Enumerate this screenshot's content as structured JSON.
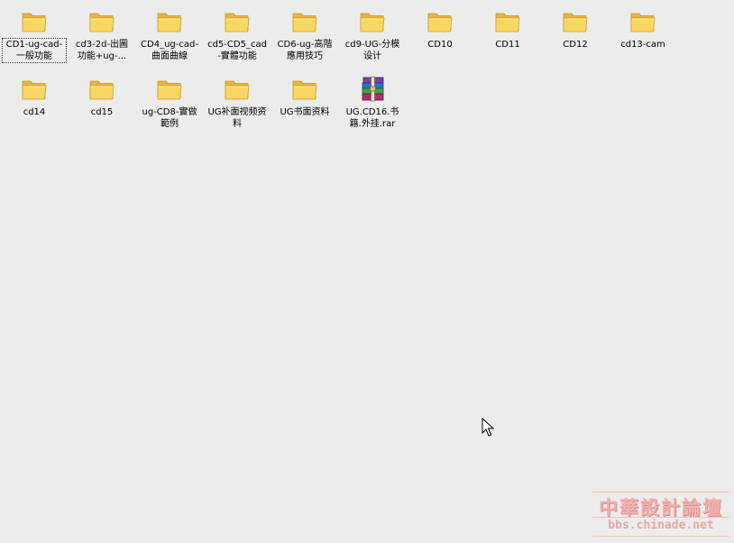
{
  "items": [
    {
      "label": "CD1-ug-cad-一般功能",
      "icon": "folder-icon",
      "selected": true
    },
    {
      "label": "cd3-2d-出圖功能+ug-...",
      "icon": "folder-icon"
    },
    {
      "label": "CD4_ug-cad-曲面曲線",
      "icon": "folder-icon"
    },
    {
      "label": "cd5-CD5_cad-實體功能",
      "icon": "folder-icon"
    },
    {
      "label": "CD6-ug-高階應用技巧",
      "icon": "folder-icon"
    },
    {
      "label": "cd9-UG-分模设计",
      "icon": "folder-icon"
    },
    {
      "label": "CD10",
      "icon": "folder-icon"
    },
    {
      "label": "CD11",
      "icon": "folder-icon"
    },
    {
      "label": "CD12",
      "icon": "folder-icon"
    },
    {
      "label": "cd13-cam",
      "icon": "folder-icon"
    },
    {
      "label": "cd14",
      "icon": "folder-icon"
    },
    {
      "label": "cd15",
      "icon": "folder-icon"
    },
    {
      "label": "ug-CD8-實做範例",
      "icon": "folder-icon"
    },
    {
      "label": "UG补面视频资料",
      "icon": "folder-icon"
    },
    {
      "label": "UG书面资料",
      "icon": "folder-icon"
    },
    {
      "label": "UG.CD16.书籍.外挂.rar",
      "icon": "winrar-archive-icon"
    }
  ],
  "watermark": {
    "title": "中華設計論壇",
    "url": "bbs.chinade.net"
  },
  "colors": {
    "background": "#ececec",
    "folder_front": "#f7d35a",
    "folder_back": "#e8b93a",
    "watermark": "#f2a6a6"
  }
}
